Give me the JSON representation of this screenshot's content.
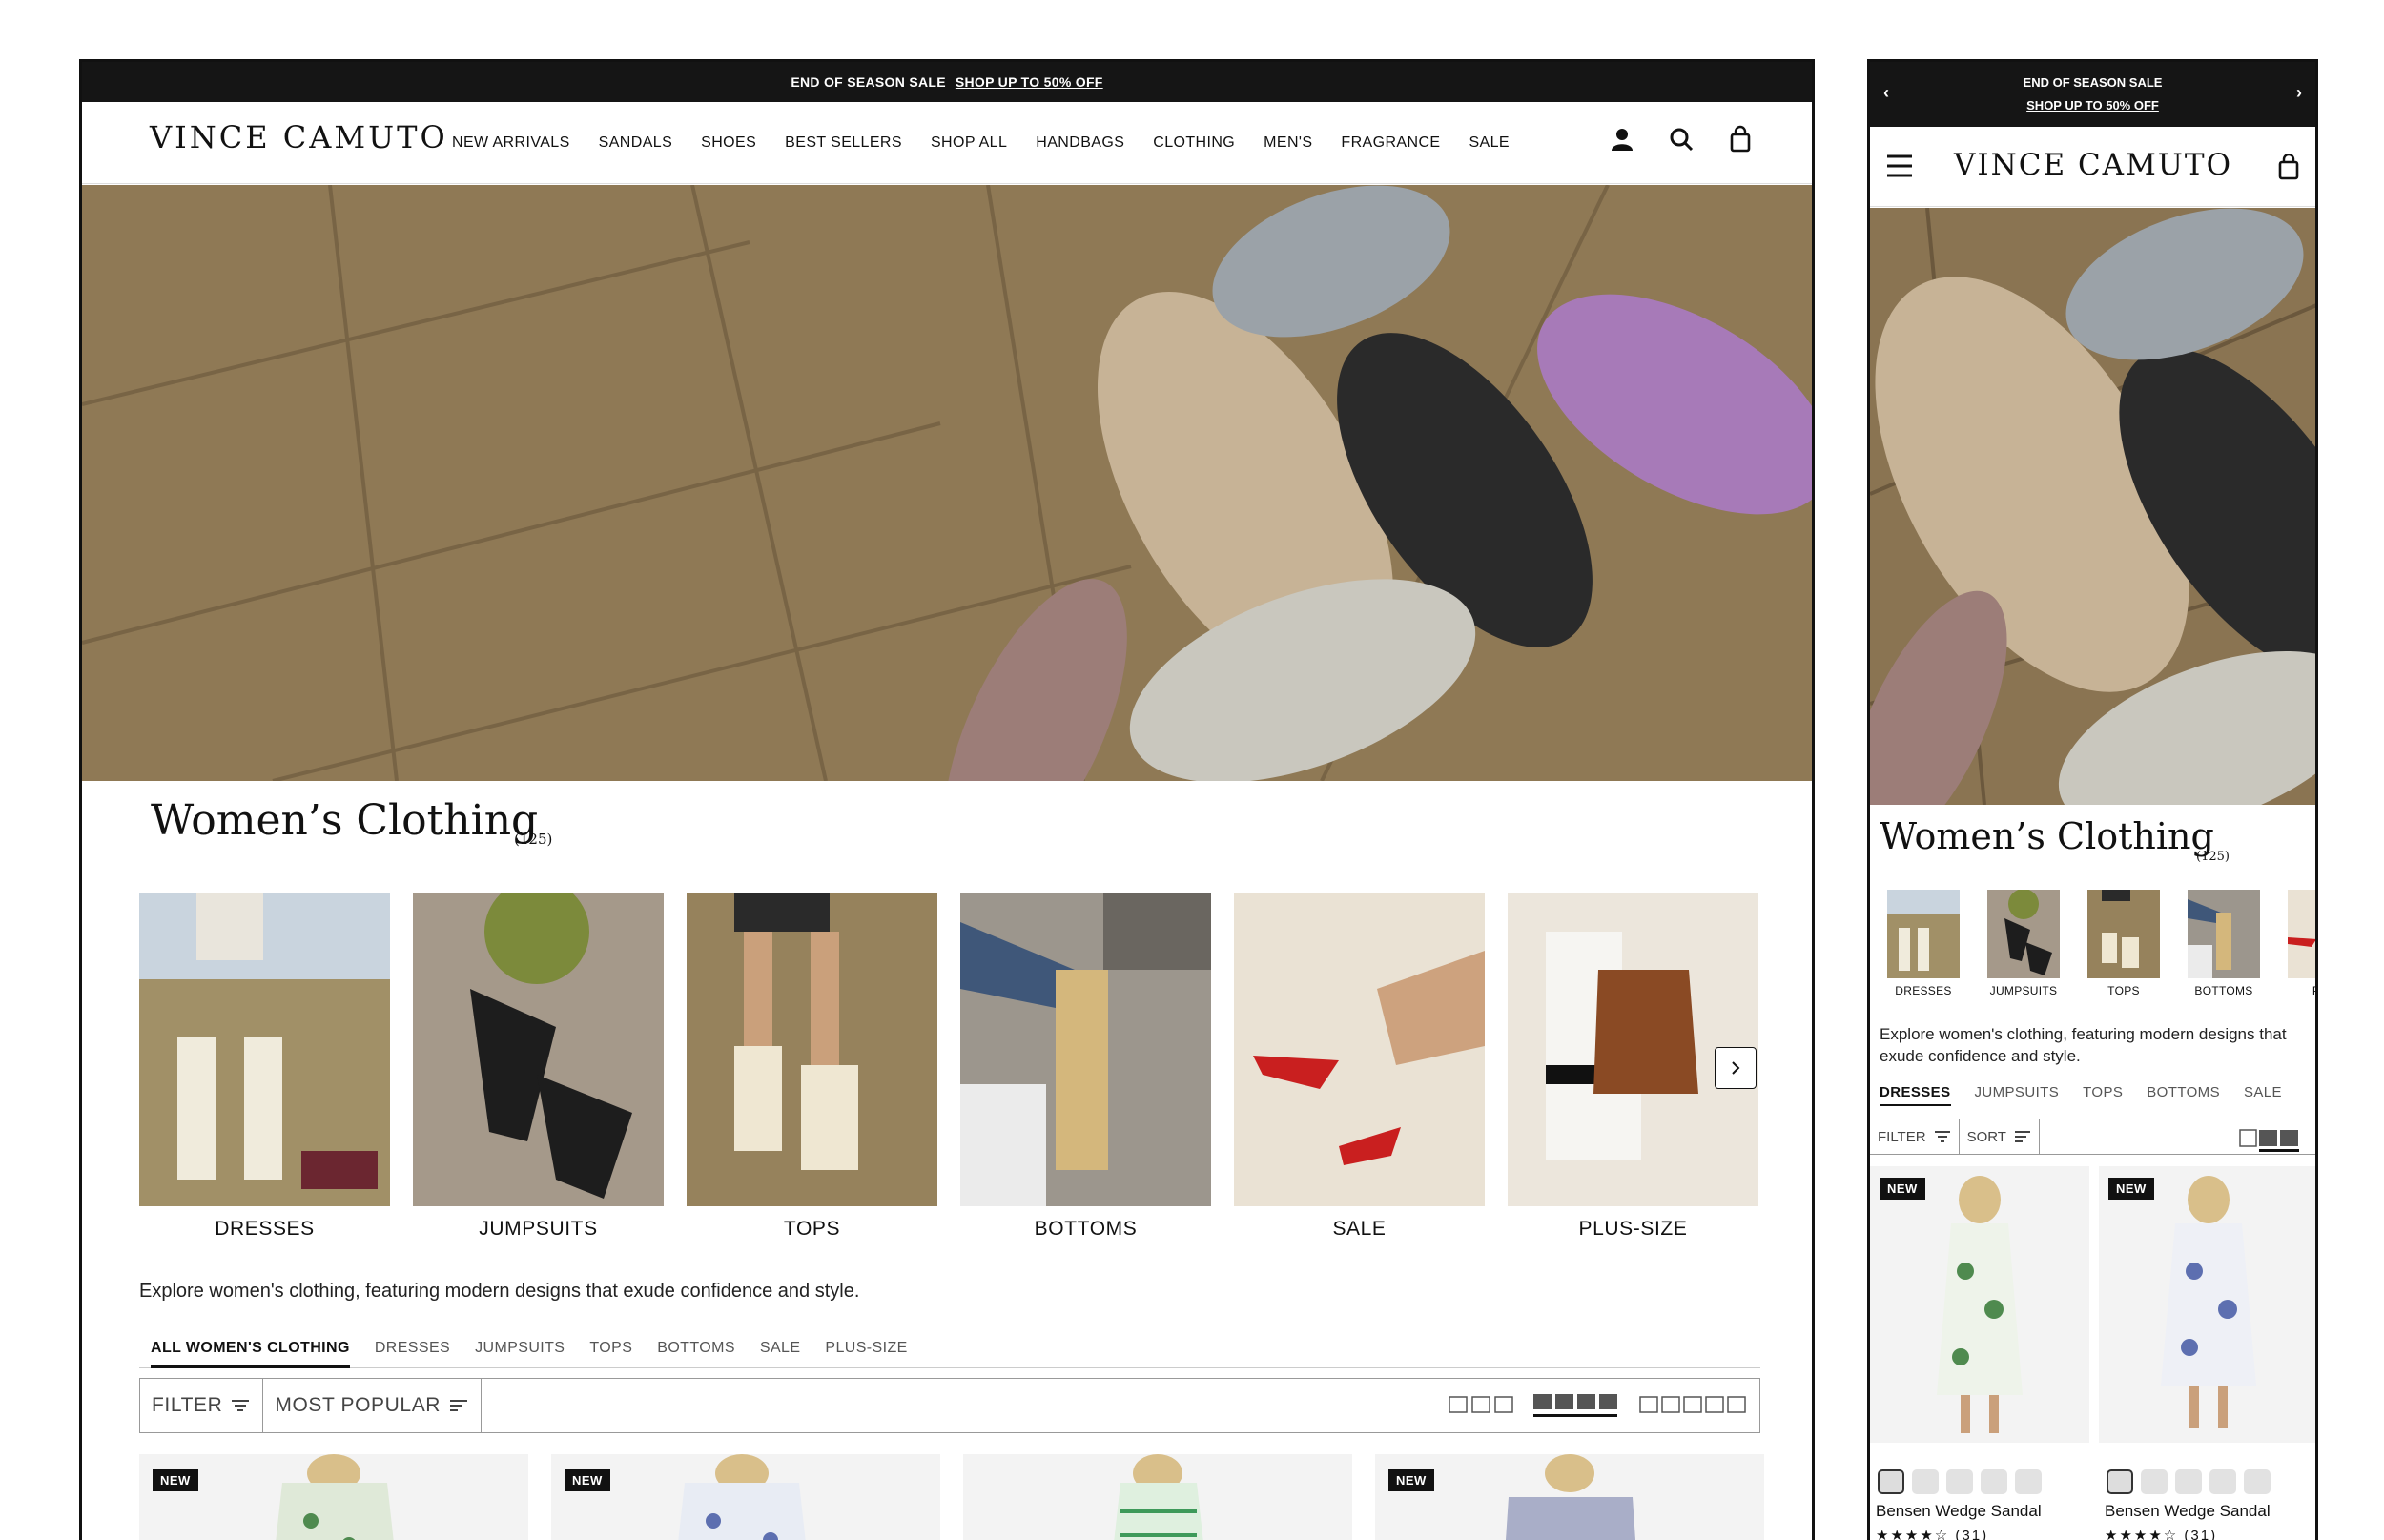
{
  "desktop": {
    "promo": {
      "text": "END OF SEASON SALE",
      "link": "SHOP UP TO 50% OFF"
    },
    "logo": "VINCE CAMUTO",
    "nav": [
      "NEW ARRIVALS",
      "SANDALS",
      "SHOES",
      "BEST SELLERS",
      "SHOP ALL",
      "HANDBAGS",
      "CLOTHING",
      "MEN'S",
      "FRAGRANCE",
      "SALE"
    ],
    "icons": [
      "account-icon",
      "search-icon",
      "cart-icon"
    ],
    "title": "Women’s Clothing",
    "count": "(125)",
    "categories": [
      "DRESSES",
      "JUMPSUITS",
      "TOPS",
      "BOTTOMS",
      "SALE",
      "PLUS-SIZE"
    ],
    "description": "Explore women's clothing, featuring modern designs that exude confidence and style.",
    "tabs": [
      "ALL WOMEN'S CLOTHING",
      "DRESSES",
      "JUMPSUITS",
      "TOPS",
      "BOTTOMS",
      "SALE",
      "PLUS-SIZE"
    ],
    "active_tab": "ALL WOMEN'S CLOTHING",
    "toolbar": {
      "filter": "FILTER",
      "sort": "MOST POPULAR",
      "grid_view_selected": "4-column"
    },
    "products": [
      {
        "badge": "NEW"
      },
      {
        "badge": "NEW"
      },
      {
        "badge": ""
      },
      {
        "badge": "NEW"
      }
    ]
  },
  "mobile": {
    "promo": {
      "text": "END OF SEASON SALE",
      "link": "SHOP UP TO 50% OFF"
    },
    "logo": "VINCE CAMUTO",
    "title": "Women’s Clothing",
    "count": "(125)",
    "categories": [
      "DRESSES",
      "JUMPSUITS",
      "TOPS",
      "BOTTOMS",
      "PLU"
    ],
    "description": "Explore women's clothing, featuring modern designs that exude confidence and style.",
    "tabs": [
      "DRESSES",
      "JUMPSUITS",
      "TOPS",
      "BOTTOMS",
      "SALE"
    ],
    "toolbar": {
      "filter": "FILTER",
      "sort": "SORT"
    },
    "products": [
      {
        "badge": "NEW",
        "name": "Bensen Wedge Sandal",
        "rating": "★★★★☆",
        "reviews": "(31)"
      },
      {
        "badge": "NEW",
        "name": "Bensen Wedge Sandal",
        "rating": "★★★★☆",
        "reviews": "(31)"
      }
    ]
  },
  "colors": {
    "promo_bg": "#151515",
    "text": "#111111",
    "border": "#999999"
  }
}
